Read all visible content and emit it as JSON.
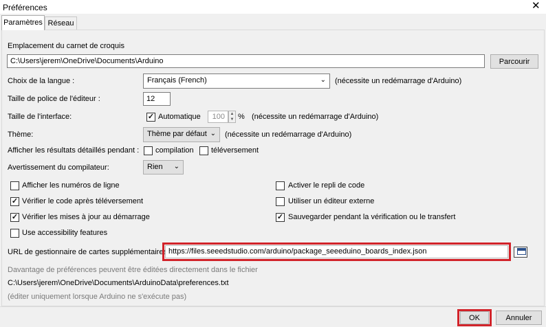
{
  "window": {
    "title": "Préférences",
    "close_glyph": "✕"
  },
  "tabs": [
    {
      "label": "Paramètres"
    },
    {
      "label": "Réseau"
    }
  ],
  "sketchbook": {
    "label": "Emplacement du carnet de croquis",
    "path": "C:\\Users\\jerem\\OneDrive\\Documents\\Arduino",
    "browse_label": "Parcourir"
  },
  "language": {
    "label": "Choix de la langue :",
    "selected": "Français (French)",
    "note": "(nécessite un redémarrage d'Arduino)"
  },
  "font_size": {
    "label": "Taille de police de l'éditeur :",
    "value": "12"
  },
  "interface_scale": {
    "label": "Taille de l'interface:",
    "auto_label": "Automatique",
    "auto_checked": true,
    "value": "100",
    "unit": "%",
    "note": "(nécessite un redémarrage d'Arduino)"
  },
  "theme": {
    "label": "Thème:",
    "selected": "Thème par défaut",
    "note": "(nécessite un redémarrage d'Arduino)"
  },
  "verbose": {
    "label": "Afficher les résultats détaillés pendant :",
    "compile_label": "compilation",
    "compile_checked": false,
    "upload_label": "téléversement",
    "upload_checked": false
  },
  "warnings": {
    "label": "Avertissement du compilateur:",
    "selected": "Rien"
  },
  "options_left": [
    {
      "label": "Afficher les numéros de ligne",
      "checked": false
    },
    {
      "label": "Vérifier le code après téléversement",
      "checked": true
    },
    {
      "label": "Vérifier les mises à jour au démarrage",
      "checked": true
    },
    {
      "label": "Use accessibility features",
      "checked": false
    }
  ],
  "options_right": [
    {
      "label": "Activer le repli de code",
      "checked": false
    },
    {
      "label": "Utiliser un éditeur externe",
      "checked": false
    },
    {
      "label": "Sauvegarder pendant la vérification ou le transfert",
      "checked": true
    }
  ],
  "boards_url": {
    "label": "URL de gestionnaire de cartes supplémentaires",
    "value": "https://files.seeedstudio.com/arduino/package_seeeduino_boards_index.json",
    "highlight_color": "#d2232a"
  },
  "more_prefs": {
    "hint": "Davantage de préférences peuvent être éditées directement dans le fichier",
    "path": "C:\\Users\\jerem\\OneDrive\\Documents\\ArduinoData\\preferences.txt",
    "note": "(éditer uniquement lorsque Arduino ne s'exécute pas)"
  },
  "footer": {
    "ok_label": "OK",
    "cancel_label": "Annuler"
  }
}
